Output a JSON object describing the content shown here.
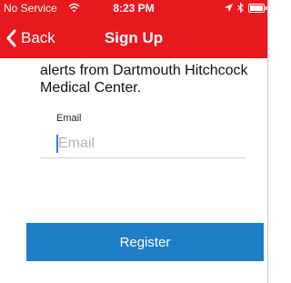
{
  "status_bar": {
    "carrier": "No Service",
    "time": "8:23 PM",
    "icons": [
      "wifi-icon",
      "location-arrow-icon",
      "bluetooth-icon",
      "battery-icon"
    ]
  },
  "nav": {
    "back_label": "Back",
    "title": "Sign Up",
    "bar_color": "#e8191e"
  },
  "content": {
    "intro_text": "alerts from Dartmouth Hitchcock Medical Center.",
    "email": {
      "label": "Email",
      "placeholder": "Email",
      "value": ""
    },
    "register_label": "Register",
    "register_color": "#1f7ec8"
  }
}
